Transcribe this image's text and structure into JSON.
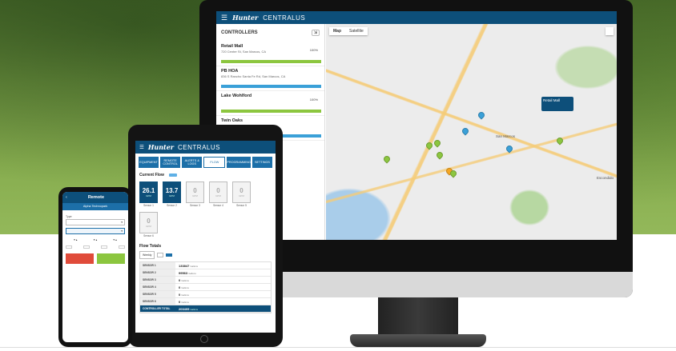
{
  "colors": {
    "brand": "#0d4f7a",
    "accent": "#1c6fa8",
    "green": "#8cc63f",
    "blue": "#3aa0d8",
    "orange": "#f5a623",
    "red": "#e04b3a"
  },
  "monitor": {
    "app": {
      "brand": "Hunter",
      "product": "CENTRALUS"
    },
    "controllers_title": "CONTROLLERS",
    "controllers": [
      {
        "name": "Retail Mall",
        "address": "720 Center St, San Marcos, CA",
        "percent": "100%",
        "status_color": "#8cc63f"
      },
      {
        "name": "PB HOA",
        "address": "836 S Rancho Santa Fe Rd, San Marcos, CA",
        "percent": "",
        "status_color": "#3aa0d8"
      },
      {
        "name": "Lake Wohlford",
        "address": "",
        "percent": "100%",
        "status_color": "#8cc63f"
      },
      {
        "name": "Twin Oaks",
        "address": "",
        "percent": "",
        "status_color": "#3aa0d8"
      }
    ],
    "map_tabs": [
      "Map",
      "Satellite"
    ],
    "map_labels": [
      "San Marcos",
      "Escondido"
    ],
    "tooltip": {
      "name": "Retail Mall"
    }
  },
  "tablet": {
    "app": {
      "brand": "Hunter",
      "product": "CENTRALUS"
    },
    "tabs": [
      "EQUIPMENT",
      "REMOTE CONTROL",
      "ALERTS & LOGS",
      "FLOW",
      "PROGRAMMING",
      "SETTINGS"
    ],
    "current_flow_title": "Current Flow",
    "current_flow_pill": "",
    "sensors": [
      {
        "value": "26.1",
        "unit": "GPM",
        "label": "Sensor 1",
        "active": true
      },
      {
        "value": "13.7",
        "unit": "GPM",
        "label": "Sensor 2",
        "active": true
      },
      {
        "value": "0",
        "unit": "GPM",
        "label": "Sensor 3",
        "active": false
      },
      {
        "value": "0",
        "unit": "GPM",
        "label": "Sensor 4",
        "active": false
      },
      {
        "value": "0",
        "unit": "GPM",
        "label": "Sensor 5",
        "active": false
      },
      {
        "value": "0",
        "unit": "GPM",
        "label": "Sensor 6",
        "active": false
      }
    ],
    "flow_totals_title": "Flow Totals",
    "totals_period": "Weekly",
    "totals_range": "",
    "totals_button": "",
    "totals": [
      {
        "label": "SENSOR 1",
        "value": "133847",
        "unit": "Gallons"
      },
      {
        "label": "SENSOR 2",
        "value": "99563",
        "unit": "Gallons"
      },
      {
        "label": "SENSOR 3",
        "value": "0",
        "unit": "Gallons"
      },
      {
        "label": "SENSOR 4",
        "value": "0",
        "unit": "Gallons"
      },
      {
        "label": "SENSOR 5",
        "value": "0",
        "unit": "Gallons"
      },
      {
        "label": "SENSOR 6",
        "value": "0",
        "unit": "Gallons"
      }
    ],
    "total_row": {
      "label": "CONTROLLER TOTAL",
      "value": "203405",
      "unit": "Gallons"
    }
  },
  "phone": {
    "title": "Remote",
    "subtitle": "Alpha Technopark",
    "type_label": "Type",
    "type_value": "",
    "mode_label": "",
    "mode_value": "",
    "chips": [
      "",
      "",
      "",
      ""
    ],
    "stop_label": "",
    "start_label": ""
  }
}
